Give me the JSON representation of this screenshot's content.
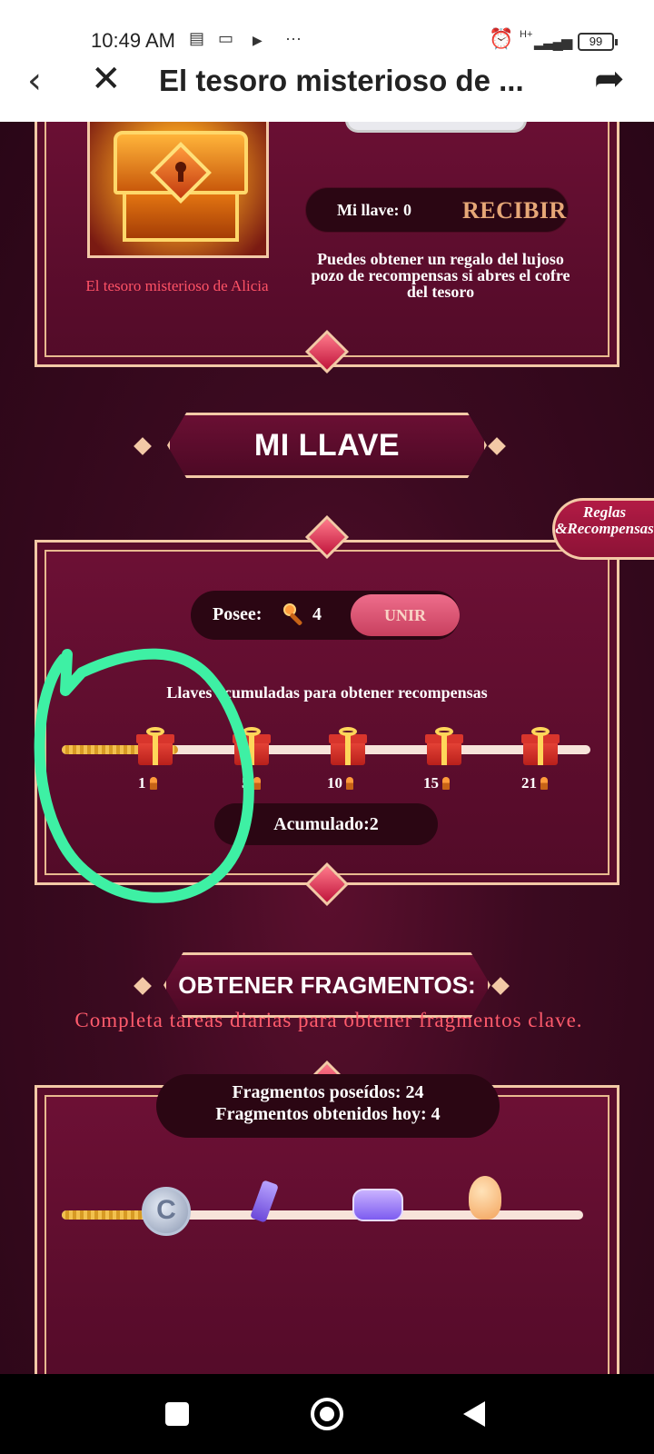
{
  "status_bar": {
    "time": "10:49 AM",
    "network": "H+",
    "battery": "99"
  },
  "app_bar": {
    "title": "El tesoro misterioso de ..."
  },
  "treasure": {
    "caption": "El tesoro misterioso de Alicia",
    "my_key_label": "Mi llave: 0",
    "receive_button": "RECIBIR",
    "description": "Puedes obtener un regalo del lujoso pozo de recompensas si abres el cofre del tesoro"
  },
  "my_key": {
    "banner": "MI LLAVE",
    "rules_tab": "Reglas &Recompensas",
    "owns_label": "Posee:",
    "owns_count": "4",
    "combine_button": "UNIR",
    "accumulated_title": "Llaves acumuladas para obtener recompensas",
    "progress_fraction": 0.22,
    "milestones": [
      "1",
      "5",
      "10",
      "15",
      "21"
    ],
    "accumulated": "Acumulado:2"
  },
  "fragments": {
    "banner": "OBTENER FRAGMENTOS:",
    "task_text": "Completa tareas diarias para obtener fragmentos clave.",
    "owned": "Fragmentos poseídos: 24",
    "today": "Fragmentos obtenidos hoy: 4",
    "progress_fraction": 0.16
  },
  "colors": {
    "accent_gold": "#f3c9a6",
    "caption_red": "#ff5266",
    "annotation_green": "#3ef0a4"
  },
  "icons": [
    "back-icon",
    "close-icon",
    "share-icon",
    "key-icon",
    "gift-icon",
    "coin-icon"
  ]
}
